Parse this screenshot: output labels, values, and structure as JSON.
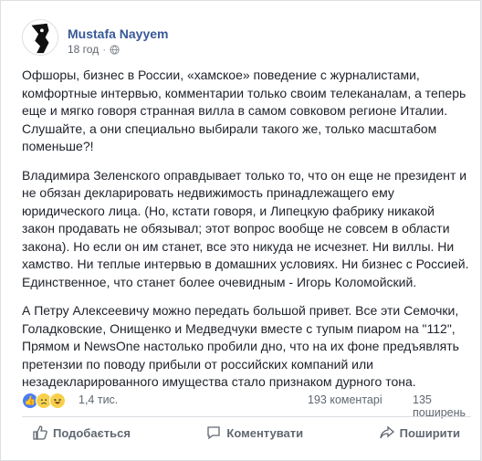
{
  "post": {
    "author": "Mustafa Nayyem",
    "time": "18 год",
    "meta_separator": "·",
    "paragraphs": [
      "Офшоры, бизнес в России, «хамское» поведение с журналистами, комфортные интервью, комментарии только своим телеканалам, а теперь еще и мягко говоря странная вилла в самом совковом регионе Италии. Слушайте, а они специально выбирали такого же, только масштабом поменьше?!",
      "Владимира Зеленского оправдывает только то, что он еще не президент и не обязан декларировать недвижимость принадлежащего ему юридического лица. (Но, кстати говоря, и Липецкую фабрику никакой закон продавать не обязывал; этот вопрос вообще не совсем в области закона). Но если он им станет, все это никуда не исчезнет. Ни виллы. Ни хамство. Ни теплые интервью в домашних условиях. Ни бизнес с Россией. Единственное, что станет более очевидным - Игорь Коломойский.",
      "А Петру Алексеевичу можно передать большой привет. Все эти Семочки, Голадковские, Онищенко и Медведчуки вместе с тупым пиаром на \"112\", Прямом и NewsOne настолько пробили дно, что на их фоне предъявлять претензии по поводу прибыли от российских компаний или незадекларированного имущества стало признаком дурного тона."
    ]
  },
  "reactions": {
    "icons": [
      "like-icon",
      "sad-icon",
      "haha-icon"
    ],
    "count": "1,4 тис.",
    "comments": "193 коментарі",
    "shares": "135 поширень"
  },
  "actions": {
    "like": "Подобається",
    "comment": "Коментувати",
    "share": "Поширити"
  },
  "colors": {
    "author": "#385898",
    "like_blue": "#4a7ff3",
    "emoji_yellow": "#f7d04b"
  }
}
